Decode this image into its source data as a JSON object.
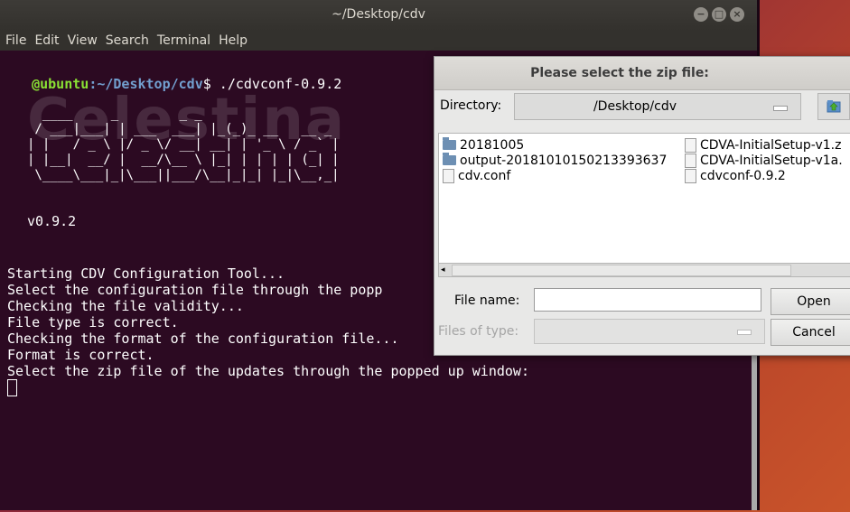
{
  "terminal": {
    "title": "~/Desktop/cdv",
    "window_buttons": [
      "−",
      "□",
      "×"
    ],
    "menu": [
      "File",
      "Edit",
      "View",
      "Search",
      "Terminal",
      "Help"
    ],
    "prompt_user": "@ubuntu",
    "prompt_path": ":~/Desktop/cdv",
    "prompt_symbol": "$",
    "command": " ./cdvconf-0.9.2",
    "ascii_art": "  ____     _        _ _\n / ___|___| | ___  ___| |_(_)_ __   __ _\n| |   / _ \\ |/ _ \\/ __| __| | '_ \\ / _` |\n| |__|  __/ |  __/\\__ \\ |_| | | | | (_| |\n \\____\\___|_|\\___||___/\\__|_|_| |_|\\__,_|",
    "ascii_watermark": "Celestina",
    "version": "v0.9.2",
    "log_lines": [
      "Starting CDV Configuration Tool...",
      "Select the configuration file through the popp",
      "Checking the file validity...",
      "File type is correct.",
      "Checking the format of the configuration file...",
      "Format is correct.",
      "Select the zip file of the updates through the popped up window:"
    ]
  },
  "dialog": {
    "title": "Please select the zip file:",
    "close_glyph": "×",
    "directory_label": "Directory:",
    "directory_value": "/Desktop/cdv",
    "files_left": [
      {
        "name": "20181005",
        "type": "folder"
      },
      {
        "name": "output-20181010150213393637",
        "type": "folder"
      },
      {
        "name": "cdv.conf",
        "type": "file"
      }
    ],
    "files_right": [
      {
        "name": "CDVA-InitialSetup-v1.z",
        "type": "file"
      },
      {
        "name": "CDVA-InitialSetup-v1a.",
        "type": "file"
      },
      {
        "name": "cdvconf-0.9.2",
        "type": "file"
      }
    ],
    "file_name_label": "File name:",
    "file_name_value": "",
    "files_of_type_label": "Files of type:",
    "files_of_type_value": "",
    "open_label": "Open",
    "cancel_label": "Cancel",
    "scroll_left": "◂",
    "scroll_right": "▸"
  }
}
